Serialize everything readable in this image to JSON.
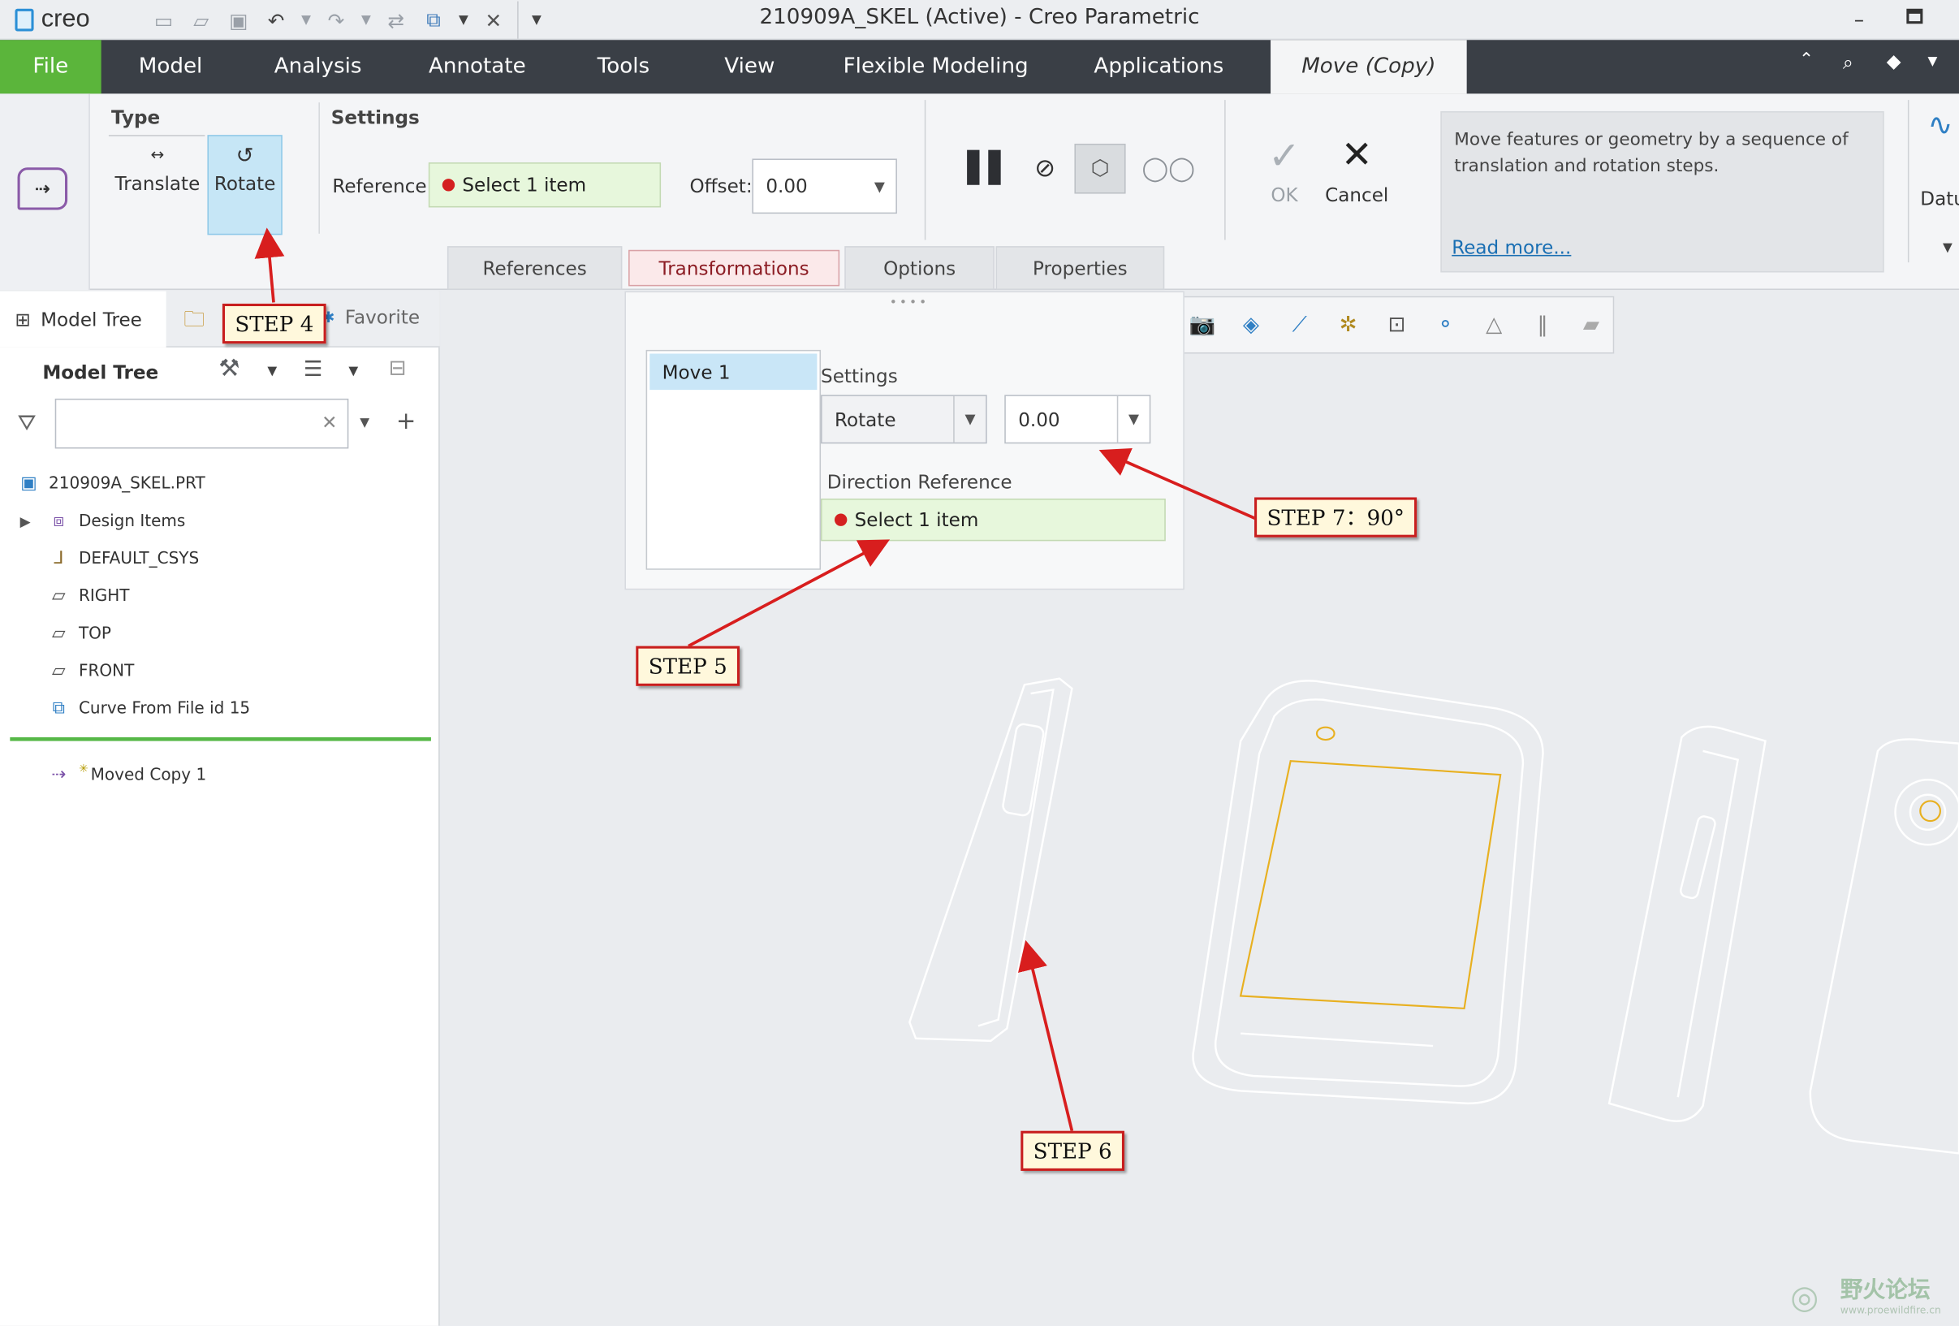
{
  "window": {
    "logo": "creo",
    "title": "210909A_SKEL (Active) - Creo Parametric"
  },
  "ribbon_tabs": [
    "File",
    "Model",
    "Analysis",
    "Annotate",
    "Tools",
    "View",
    "Flexible Modeling",
    "Applications",
    "Move (Copy)"
  ],
  "type_group": {
    "title": "Type",
    "translate": "Translate",
    "rotate": "Rotate"
  },
  "settings_group": {
    "title": "Settings",
    "reference_label": "Reference:",
    "reference_value": "Select 1 item",
    "offset_label": "Offset:",
    "offset_value": "0.00"
  },
  "actions": {
    "ok": "OK",
    "cancel": "Cancel"
  },
  "info": {
    "text": "Move features or geometry by a sequence of translation and rotation steps.",
    "link": "Read more..."
  },
  "right_cut_label": "Datu",
  "subtabs": [
    "References",
    "Transformations",
    "Options",
    "Properties"
  ],
  "panel_tabs": {
    "model_tree": "Model Tree",
    "favorites": "Favorite"
  },
  "tree": {
    "header": "Model Tree",
    "search_placeholder": "",
    "items": [
      "210909A_SKEL.PRT",
      "Design Items",
      "DEFAULT_CSYS",
      "RIGHT",
      "TOP",
      "FRONT",
      "Curve From File id 15"
    ],
    "inserted": "Moved Copy 1"
  },
  "transform_panel": {
    "move_item": "Move 1",
    "settings_label": "Settings",
    "mode_value": "Rotate",
    "angle_value": "0.00",
    "direction_label": "Direction Reference",
    "direction_value": "Select 1 item"
  },
  "callouts": {
    "step4": "STEP  4",
    "step5": "STEP  5",
    "step6": "STEP  6",
    "step7": "STEP  7：90°"
  },
  "watermark": {
    "text": "野火论坛",
    "url": "www.proewildfire.cn"
  },
  "colors": {
    "file_tab": "#5bb53b",
    "ribbon_dark": "#3a3f46",
    "select_green": "#e7f7dc",
    "callout_red": "#c81e1e"
  }
}
